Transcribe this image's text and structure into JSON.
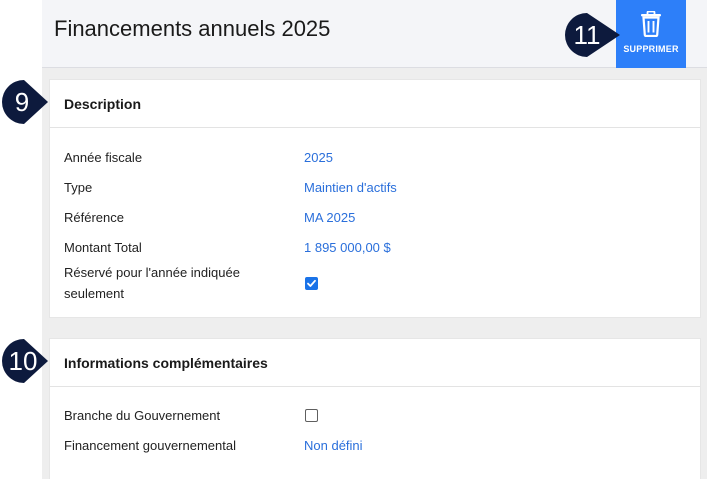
{
  "header": {
    "title": "Financements annuels 2025",
    "delete_label": "SUPPRIMER"
  },
  "description": {
    "title": "Description",
    "rows": [
      {
        "label": "Année fiscale",
        "value": "2025"
      },
      {
        "label": "Type",
        "value": "Maintien d'actifs"
      },
      {
        "label": "Référence",
        "value": "MA 2025"
      },
      {
        "label": "Montant Total",
        "value": "1 895 000,00 $"
      },
      {
        "label": "Réservé pour l'année indiquée seulement",
        "checked": true
      }
    ]
  },
  "info": {
    "title": "Informations complémentaires",
    "rows": [
      {
        "label": "Branche du Gouvernement",
        "checked": false
      },
      {
        "label": "Financement gouvernemental",
        "value": "Non défini"
      }
    ]
  },
  "badges": [
    "9",
    "10",
    "11"
  ],
  "colors": {
    "accent": "#2d7ff9",
    "link": "#2a6fdb",
    "badge": "#0d1a3d"
  }
}
